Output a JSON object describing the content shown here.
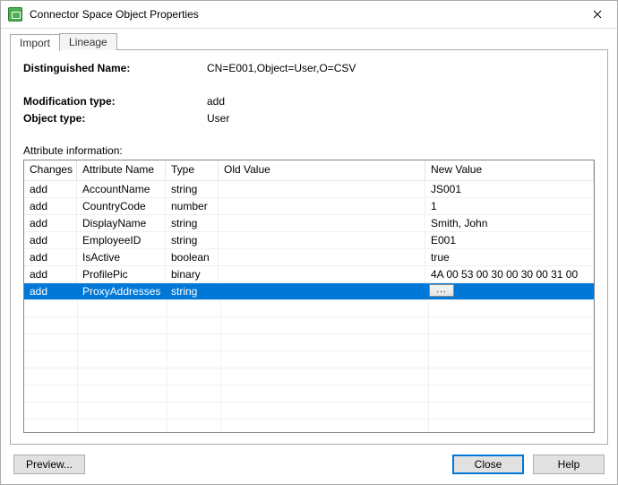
{
  "window": {
    "title": "Connector Space Object Properties"
  },
  "tabs": [
    {
      "label": "Import",
      "active": true
    },
    {
      "label": "Lineage",
      "active": false
    }
  ],
  "details": {
    "dn_label": "Distinguished Name:",
    "dn_value": "CN=E001,Object=User,O=CSV",
    "mod_type_label": "Modification type:",
    "mod_type_value": "add",
    "obj_type_label": "Object type:",
    "obj_type_value": "User"
  },
  "attr_section_label": "Attribute information:",
  "columns": {
    "changes": "Changes",
    "attribute_name": "Attribute Name",
    "type": "Type",
    "old_value": "Old Value",
    "new_value": "New Value"
  },
  "rows": [
    {
      "changes": "add",
      "attr": "AccountName",
      "type": "string",
      "old": "",
      "new": "JS001",
      "selected": false,
      "has_button": false
    },
    {
      "changes": "add",
      "attr": "CountryCode",
      "type": "number",
      "old": "",
      "new": "1",
      "selected": false,
      "has_button": false
    },
    {
      "changes": "add",
      "attr": "DisplayName",
      "type": "string",
      "old": "",
      "new": "Smith, John",
      "selected": false,
      "has_button": false
    },
    {
      "changes": "add",
      "attr": "EmployeeID",
      "type": "string",
      "old": "",
      "new": "E001",
      "selected": false,
      "has_button": false
    },
    {
      "changes": "add",
      "attr": "IsActive",
      "type": "boolean",
      "old": "",
      "new": "true",
      "selected": false,
      "has_button": false
    },
    {
      "changes": "add",
      "attr": "ProfilePic",
      "type": "binary",
      "old": "",
      "new": "4A 00 53 00 30 00 30 00 31 00",
      "selected": false,
      "has_button": false
    },
    {
      "changes": "add",
      "attr": "ProxyAddresses",
      "type": "string",
      "old": "",
      "new": "",
      "selected": true,
      "has_button": true
    }
  ],
  "buttons": {
    "preview": "Preview...",
    "close": "Close",
    "help": "Help",
    "ellipsis": "..."
  }
}
